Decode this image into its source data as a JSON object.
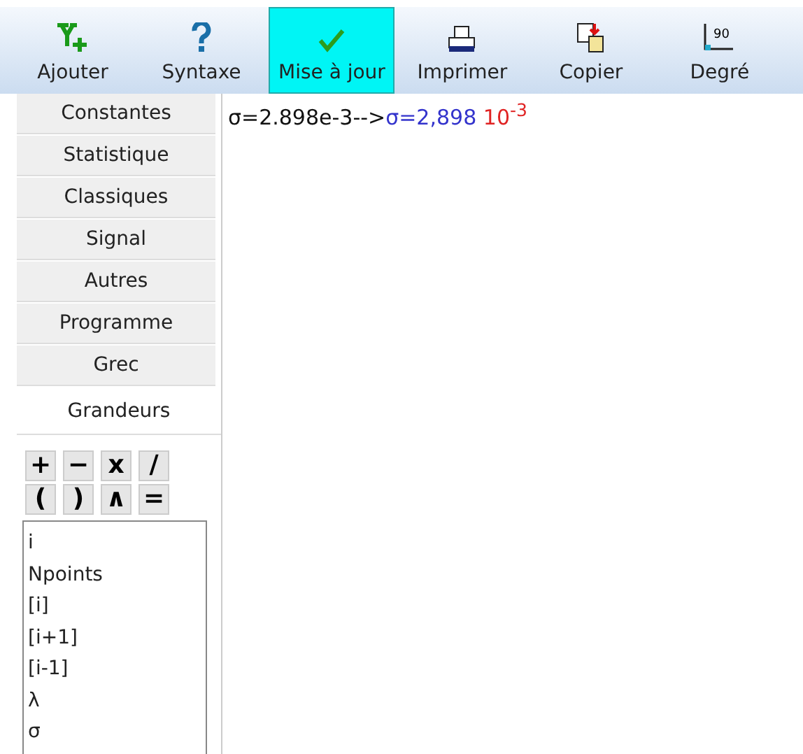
{
  "toolbar": [
    {
      "kind": "add",
      "label": "Ajouter",
      "selected": false
    },
    {
      "kind": "help",
      "label": "Syntaxe",
      "selected": false
    },
    {
      "kind": "check",
      "label": "Mise à jour",
      "selected": true
    },
    {
      "kind": "print",
      "label": "Imprimer",
      "selected": false
    },
    {
      "kind": "copy",
      "label": "Copier",
      "selected": false
    },
    {
      "kind": "angle",
      "label": "Degré",
      "icon_text": "90",
      "selected": false
    }
  ],
  "sidebar": {
    "tabs": [
      {
        "label": "Constantes",
        "selected": false
      },
      {
        "label": "Statistique",
        "selected": false
      },
      {
        "label": "Classiques",
        "selected": false
      },
      {
        "label": "Signal",
        "selected": false
      },
      {
        "label": "Autres",
        "selected": false
      },
      {
        "label": "Programme",
        "selected": false
      },
      {
        "label": "Grec",
        "selected": false
      },
      {
        "label": "Grandeurs",
        "selected": true
      }
    ],
    "operators": [
      "+",
      "−",
      "x",
      "/",
      "(",
      ")",
      "∧",
      "="
    ],
    "list": [
      "i",
      "Npoints",
      "[i]",
      "[i+1]",
      "[i-1]",
      "λ",
      "σ"
    ]
  },
  "editor": {
    "segments": [
      {
        "text": "σ=2.898e-3-->",
        "color": "#111111"
      },
      {
        "text": "σ=2,898",
        "color": "#3333cc"
      },
      {
        "text": "10$^{-3}$",
        "color": "#e02424"
      }
    ]
  }
}
